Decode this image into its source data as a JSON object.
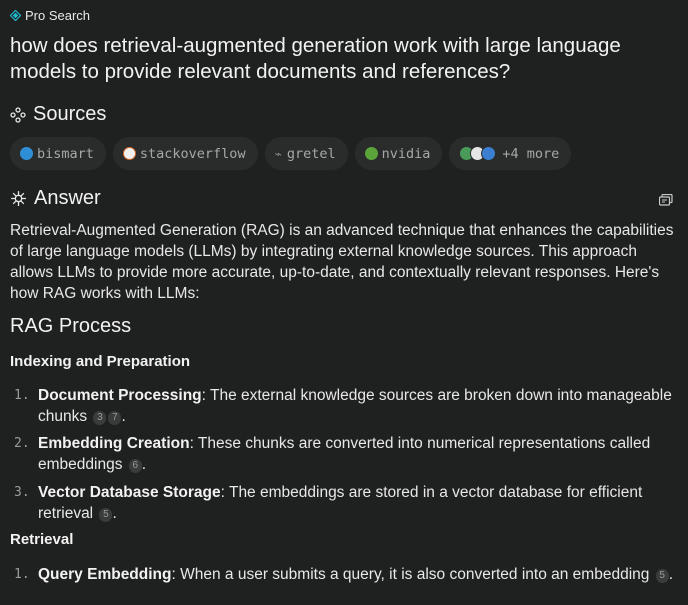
{
  "header": {
    "mode_label": "Pro Search"
  },
  "question": "how does retrieval-augmented generation work with large language models to provide relevant documents and references?",
  "sources": {
    "title": "Sources",
    "chips": [
      {
        "label": "bismart"
      },
      {
        "label": "stackoverflow"
      },
      {
        "label": "gretel"
      },
      {
        "label": "nvidia"
      },
      {
        "label": "+4 more"
      }
    ]
  },
  "answer": {
    "title": "Answer",
    "intro": "Retrieval-Augmented Generation (RAG) is an advanced technique that enhances the capabilities of large language models (LLMs) by integrating external knowledge sources. This approach allows LLMs to provide more accurate, up-to-date, and contextually relevant responses. Here's how RAG works with LLMs:",
    "heading": "RAG Process",
    "sections": [
      {
        "title": "Indexing and Preparation",
        "items": [
          {
            "num": "1.",
            "term": "Document Processing",
            "text": ": The external knowledge sources are broken down into manageable chunks",
            "cites": [
              "3",
              "7"
            ],
            "end": "."
          },
          {
            "num": "2.",
            "term": "Embedding Creation",
            "text": ": These chunks are converted into numerical representations called embeddings",
            "cites": [
              "6"
            ],
            "end": "."
          },
          {
            "num": "3.",
            "term": "Vector Database Storage",
            "text": ": The embeddings are stored in a vector database for efficient retrieval",
            "cites": [
              "5"
            ],
            "end": "."
          }
        ]
      },
      {
        "title": "Retrieval",
        "items": [
          {
            "num": "1.",
            "term": "Query Embedding",
            "text": ": When a user submits a query, it is also converted into an embedding",
            "cites": [
              "5"
            ],
            "end": "."
          }
        ]
      }
    ]
  },
  "colors": {
    "background": "#1f2121",
    "chip": "#2a2c2c",
    "accent": "#20b8cd"
  }
}
